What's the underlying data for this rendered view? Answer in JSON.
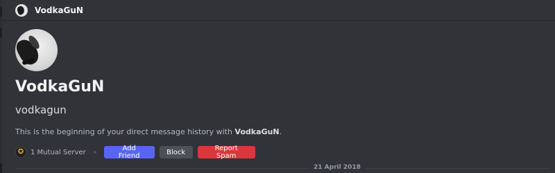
{
  "header": {
    "title": "VodkaGuN",
    "avatar_icon": "user-avatar-icon"
  },
  "profile": {
    "display_name": "VodkaGuN",
    "username": "vodkagun",
    "history_prefix": "This is the beginning of your direct message history with ",
    "history_name": "VodkaGuN",
    "history_suffix": "."
  },
  "mutual": {
    "label": "1 Mutual Server",
    "icon": "server-emblem-icon"
  },
  "actions": {
    "add_friend": "Add Friend",
    "block": "Block",
    "report_spam": "Report Spam"
  },
  "divider": {
    "date": "21 April 2018"
  },
  "colors": {
    "background": "#313338",
    "add_friend": "#5865f2",
    "block": "#4e5058",
    "report_spam": "#da373c"
  }
}
